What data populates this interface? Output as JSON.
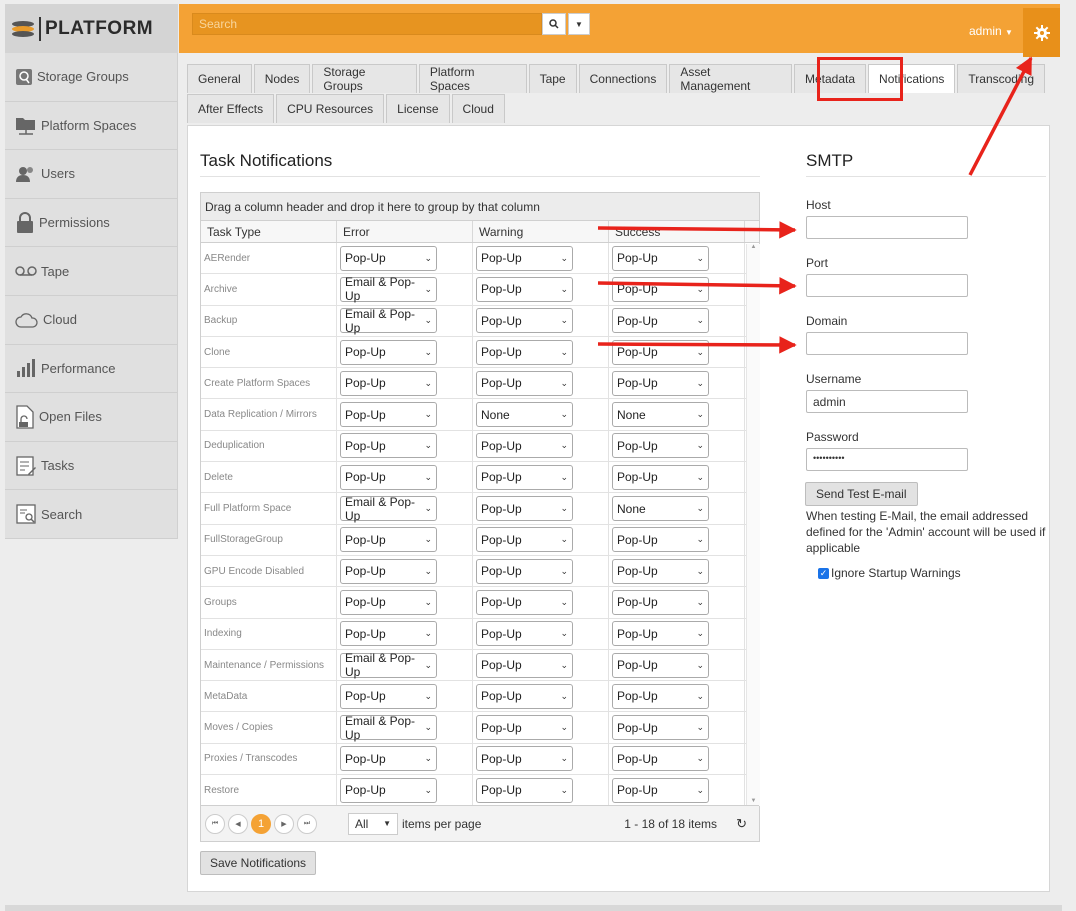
{
  "logo": {
    "text": "PLATFORM"
  },
  "sidebar": {
    "items": [
      {
        "label": "Storage Groups",
        "icon": "storage-groups-icon"
      },
      {
        "label": "Platform Spaces",
        "icon": "platform-spaces-icon"
      },
      {
        "label": "Users",
        "icon": "users-icon"
      },
      {
        "label": "Permissions",
        "icon": "lock-icon"
      },
      {
        "label": "Tape",
        "icon": "tape-icon"
      },
      {
        "label": "Cloud",
        "icon": "cloud-icon"
      },
      {
        "label": "Performance",
        "icon": "performance-icon"
      },
      {
        "label": "Open Files",
        "icon": "open-files-icon"
      },
      {
        "label": "Tasks",
        "icon": "tasks-icon"
      },
      {
        "label": "Search",
        "icon": "search-list-icon"
      }
    ]
  },
  "topbar": {
    "search_placeholder": "Search",
    "user": "admin",
    "accent": "#f4a235"
  },
  "tabs": {
    "row1": [
      "General",
      "Nodes",
      "Storage Groups",
      "Platform Spaces",
      "Tape",
      "Connections",
      "Asset Management",
      "Metadata",
      "Notifications",
      "Transcoding"
    ],
    "row2": [
      "After Effects",
      "CPU Resources",
      "License",
      "Cloud"
    ],
    "active": "Notifications"
  },
  "task_notifications": {
    "title": "Task Notifications",
    "group_hint": "Drag a column header and drop it here to group by that column",
    "columns": [
      "Task Type",
      "Error",
      "Warning",
      "Success"
    ],
    "rows": [
      [
        "AERender",
        "Pop-Up",
        "Pop-Up",
        "Pop-Up"
      ],
      [
        "Archive",
        "Email & Pop-Up",
        "Pop-Up",
        "Pop-Up"
      ],
      [
        "Backup",
        "Email & Pop-Up",
        "Pop-Up",
        "Pop-Up"
      ],
      [
        "Clone",
        "Pop-Up",
        "Pop-Up",
        "Pop-Up"
      ],
      [
        "Create Platform Spaces",
        "Pop-Up",
        "Pop-Up",
        "Pop-Up"
      ],
      [
        "Data Replication / Mirrors",
        "Pop-Up",
        "None",
        "None"
      ],
      [
        "Deduplication",
        "Pop-Up",
        "Pop-Up",
        "Pop-Up"
      ],
      [
        "Delete",
        "Pop-Up",
        "Pop-Up",
        "Pop-Up"
      ],
      [
        "Full Platform Space",
        "Email & Pop-Up",
        "Pop-Up",
        "None"
      ],
      [
        "FullStorageGroup",
        "Pop-Up",
        "Pop-Up",
        "Pop-Up"
      ],
      [
        "GPU Encode Disabled",
        "Pop-Up",
        "Pop-Up",
        "Pop-Up"
      ],
      [
        "Groups",
        "Pop-Up",
        "Pop-Up",
        "Pop-Up"
      ],
      [
        "Indexing",
        "Pop-Up",
        "Pop-Up",
        "Pop-Up"
      ],
      [
        "Maintenance / Permissions",
        "Email & Pop-Up",
        "Pop-Up",
        "Pop-Up"
      ],
      [
        "MetaData",
        "Pop-Up",
        "Pop-Up",
        "Pop-Up"
      ],
      [
        "Moves / Copies",
        "Email & Pop-Up",
        "Pop-Up",
        "Pop-Up"
      ],
      [
        "Proxies / Transcodes",
        "Pop-Up",
        "Pop-Up",
        "Pop-Up"
      ],
      [
        "Restore",
        "Pop-Up",
        "Pop-Up",
        "Pop-Up"
      ]
    ],
    "pager": {
      "current_page": "1",
      "per_page": "All",
      "per_page_label": "items per page",
      "count": "1 - 18 of 18 items"
    },
    "save_label": "Save Notifications"
  },
  "smtp": {
    "title": "SMTP",
    "host_label": "Host",
    "host_value": "",
    "port_label": "Port",
    "port_value": "",
    "domain_label": "Domain",
    "domain_value": "",
    "username_label": "Username",
    "username_value": "admin",
    "password_label": "Password",
    "password_value": "••••••••••",
    "test_button": "Send Test E-mail",
    "test_note": "When testing E-Mail, the email addressed defined for the 'Admin' account will be used if applicable",
    "ignore_label": "Ignore Startup Warnings",
    "ignore_checked": true
  },
  "annotation_color": "#e8231b"
}
